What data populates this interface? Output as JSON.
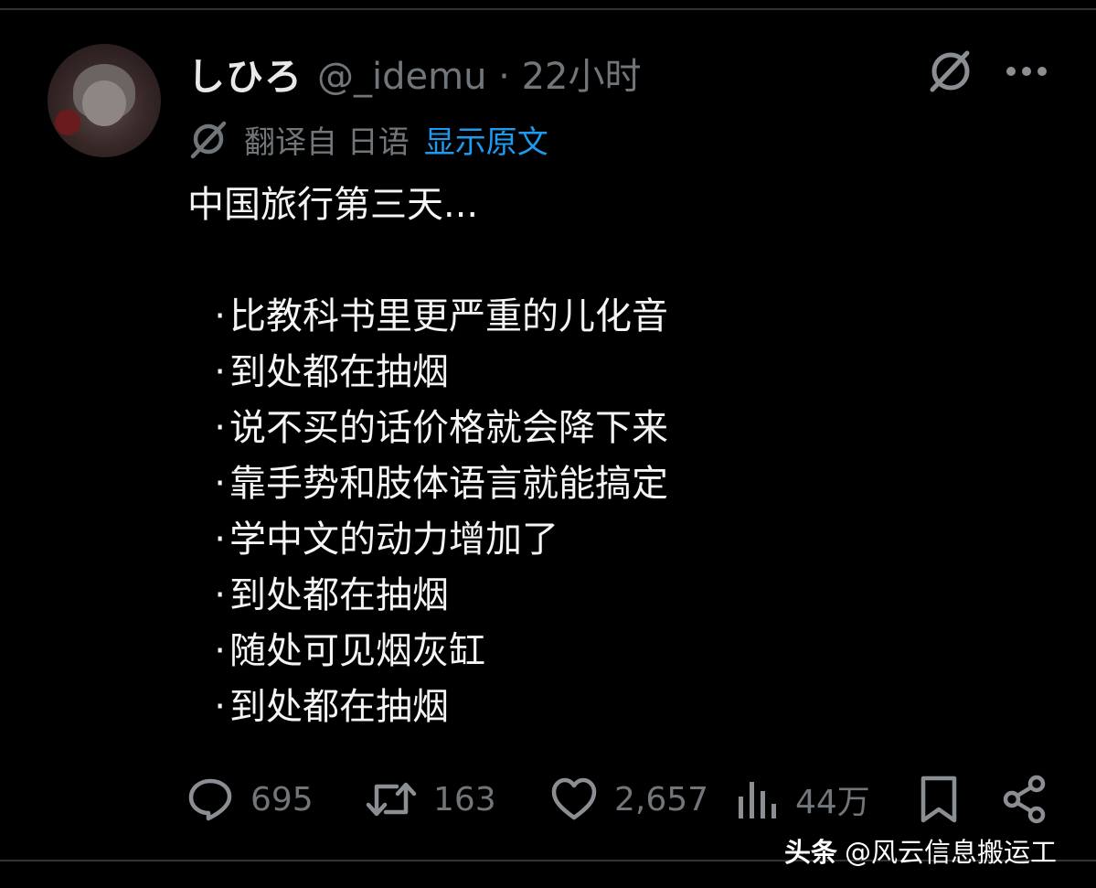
{
  "author": {
    "display_name": "しひろ",
    "handle_time": "@_idemu · 22小时"
  },
  "translation": {
    "note": "翻译自 日语",
    "show_original_label": "显示原文"
  },
  "tweet": {
    "intro": "中国旅行第三天...",
    "bullet_char": "·",
    "bullets": [
      "比教科书里更严重的儿化音",
      "到处都在抽烟",
      "说不买的话价格就会降下来",
      "靠手势和肢体语言就能搞定",
      "学中文的动力增加了",
      "到处都在抽烟",
      "随处可见烟灰缸",
      "到处都在抽烟"
    ]
  },
  "actions": {
    "reply_count": "695",
    "retweet_count": "163",
    "like_count": "2,657",
    "view_count": "44万"
  },
  "icons": [
    "grok-icon",
    "more-icon",
    "translate-icon",
    "reply-icon",
    "retweet-icon",
    "like-icon",
    "views-icon",
    "bookmark-icon",
    "share-icon"
  ],
  "watermark": {
    "brand": "头条",
    "account": "@风云信息搬运工"
  },
  "colors": {
    "background": "#000000",
    "text": "#e7e9ea",
    "muted": "#71767b",
    "link": "#1d9bf0"
  }
}
